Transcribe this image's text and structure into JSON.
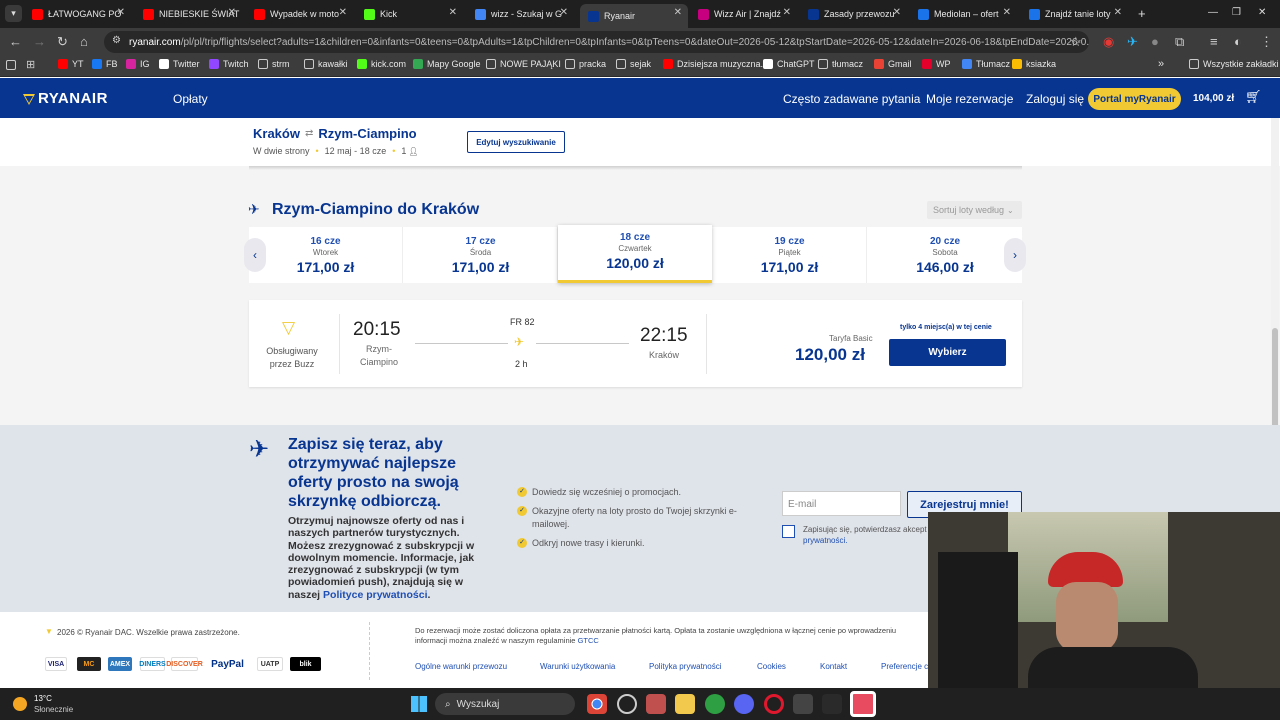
{
  "browser": {
    "tabs": [
      {
        "title": "ŁATWOGANG PO",
        "icon": "youtube-icon",
        "color": "#ff0000"
      },
      {
        "title": "NIEBIESKIE ŚWIAT",
        "icon": "youtube-icon",
        "color": "#ff0000"
      },
      {
        "title": "Wypadek w moto",
        "icon": "youtube-icon",
        "color": "#ff0000"
      },
      {
        "title": "Kick",
        "icon": "kick-icon",
        "color": "#53fc18"
      },
      {
        "title": "wizz - Szukaj w G",
        "icon": "google-icon",
        "color": "#4285f4"
      },
      {
        "title": "Ryanair",
        "icon": "ryanair-icon",
        "color": "#073590"
      },
      {
        "title": "Wizz Air | Znajdź",
        "icon": "wizzair-icon",
        "color": "#c6007e"
      },
      {
        "title": "Zasady przewozu",
        "icon": "ryanair-icon",
        "color": "#073590"
      },
      {
        "title": "Mediolan – ofert",
        "icon": "site-icon",
        "color": "#1a73e8"
      },
      {
        "title": "Znajdź tanie loty",
        "icon": "site-icon",
        "color": "#1a73e8"
      }
    ],
    "new_tab": "+",
    "url_host": "ryanair.com",
    "url_path": "/pl/pl/trip/flights/select?adults=1&children=0&infants=0&teens=0&tpAdults=1&tpChildren=0&tpInfants=0&tpTeens=0&dateOut=2026-05-12&tpStartDate=2026-05-12&dateIn=2026-06-18&tpEndDate=2026-0..."
  },
  "bookmarks": [
    {
      "label": "YT",
      "color": "#ff0000"
    },
    {
      "label": "FB",
      "color": "#1877f2"
    },
    {
      "label": "IG",
      "color": "#d6249f"
    },
    {
      "label": "Twitter",
      "color": "#ffffff"
    },
    {
      "label": "Twitch",
      "color": "#9146ff"
    },
    {
      "label": "strm",
      "color": "folder"
    },
    {
      "label": "kawałki",
      "color": "folder"
    },
    {
      "label": "kick.com",
      "color": "#53fc18"
    },
    {
      "label": "Mapy Google",
      "color": "#34a853"
    },
    {
      "label": "NOWE PAJĄKI",
      "color": "folder"
    },
    {
      "label": "pracka",
      "color": "folder"
    },
    {
      "label": "sejak",
      "color": "folder"
    },
    {
      "label": "Dzisiejsza muzyczna...",
      "color": "#ff0000"
    },
    {
      "label": "ChatGPT",
      "color": "#ffffff"
    },
    {
      "label": "tłumacz",
      "color": "folder"
    },
    {
      "label": "Gmail",
      "color": "#ea4335"
    },
    {
      "label": "WP",
      "color": "#e4002b"
    },
    {
      "label": "Tłumacz",
      "color": "#4285f4"
    },
    {
      "label": "ksiazka",
      "color": "#fbbc04"
    }
  ],
  "bookmarks_more": "»",
  "bookmarks_all": "Wszystkie zakładki",
  "ryanair": {
    "logo": "RYANAIR",
    "nav_fares": "Opłaty",
    "faq": "Często zadawane pytania",
    "my_bookings": "Moje rezerwacje",
    "login": "Zaloguj się",
    "portal": "Portal myRyanair",
    "basket_total": "104,00 zł"
  },
  "summary": {
    "origin": "Kraków",
    "destination": "Rzym-Ciampino",
    "trip_type": "W dwie strony",
    "dates": "12 maj - 18 cze",
    "passengers": "1",
    "edit_button": "Edytuj wyszukiwanie"
  },
  "return_section": {
    "title": "Rzym-Ciampino do Kraków",
    "sort_label": "Sortuj loty według",
    "days": [
      {
        "date": "16 cze",
        "weekday": "Wtorek",
        "price": "171,00 zł",
        "selected": false
      },
      {
        "date": "17 cze",
        "weekday": "Środa",
        "price": "171,00 zł",
        "selected": false
      },
      {
        "date": "18 cze",
        "weekday": "Czwartek",
        "price": "120,00 zł",
        "selected": true
      },
      {
        "date": "19 cze",
        "weekday": "Piątek",
        "price": "171,00 zł",
        "selected": false
      },
      {
        "date": "20 cze",
        "weekday": "Sobota",
        "price": "146,00 zł",
        "selected": false
      }
    ]
  },
  "flight": {
    "operator": "Obsługiwany przez Buzz",
    "depart_time": "20:15",
    "depart_city": "Rzym-Ciampino",
    "flight_no": "FR 82",
    "duration": "2 h",
    "arrive_time": "22:15",
    "arrive_city": "Kraków",
    "fare_name": "Taryfa Basic",
    "price": "120,00 zł",
    "seats_left": "tylko 4 miejsc(a) w tej cenie",
    "select_button": "Wybierz"
  },
  "newsletter": {
    "headline": "Zapisz się teraz, aby otrzymywać najlepsze oferty prosto na swoją skrzynkę odbiorczą.",
    "body": "Otrzymuj najnowsze oferty od nas i naszych partnerów turystycznych. Możesz zrezygnować z subskrypcji w dowolnym momencie. Informacje, jak zrezygnować z subskrypcji (w tym powiadomień push), znajdują się w naszej",
    "privacy_link": "Polityce prywatności",
    "period": ".",
    "benefits": [
      "Dowiedz się wcześniej o promocjach.",
      "Okazyjne oferty na loty prosto do Twojej skrzynki e-mailowej.",
      "Odkryj nowe trasy i kierunki."
    ],
    "email_placeholder": "E-mail",
    "register_button": "Zarejestruj mnie!",
    "consent_text": "Zapisując się, potwierdzasz akcept",
    "consent_link": "prywatności."
  },
  "footer": {
    "copyright": "2026 © Ryanair DAC. Wszelkie prawa zastrzeżone.",
    "fee_note": "Do rezerwacji może zostać doliczona opłata za przetwarzanie płatności kartą. Opłata ta zostanie uwzględniona w łącznej cenie po wprowadzeniu",
    "fee_note2": "informacji można znaleźć w naszym regulaminie",
    "gtcc": "GTCC",
    "payments": [
      "VISA",
      "MC",
      "AMEX",
      "DINERS",
      "DISCOVER",
      "PayPal",
      "UATP",
      "blik"
    ],
    "links": [
      "Ogólne warunki przewozu",
      "Warunki użytkowania",
      "Polityka prywatności",
      "Cookies",
      "Kontakt",
      "Preferencje c"
    ]
  },
  "taskbar": {
    "weather_temp": "13°C",
    "weather_desc": "Słonecznie",
    "search_placeholder": "Wyszukaj"
  }
}
